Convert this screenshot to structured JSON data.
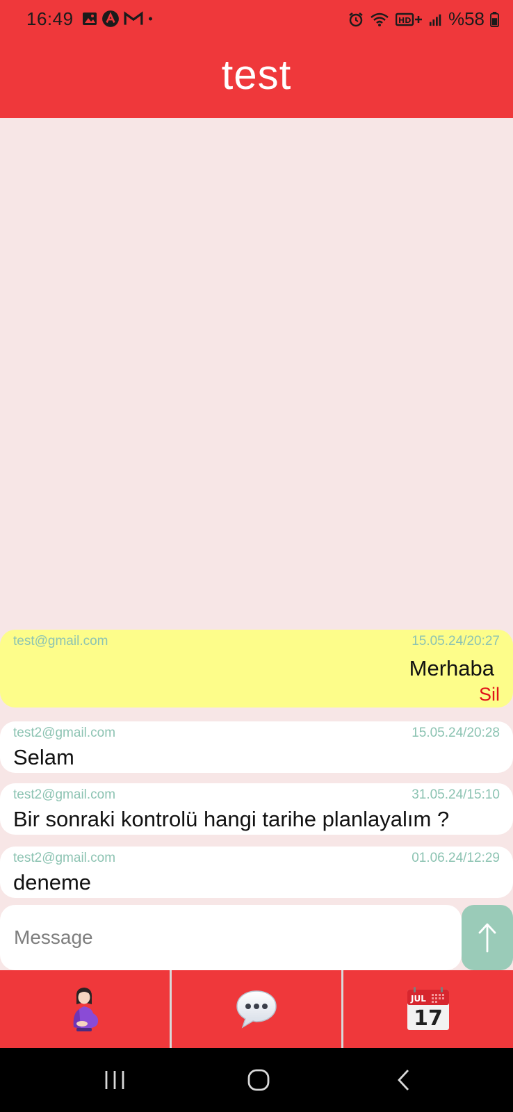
{
  "status": {
    "time": "16:49",
    "battery": "%58",
    "icons": [
      "gallery-icon",
      "app-notification-icon",
      "gmail-icon",
      "dot-icon",
      "alarm-icon",
      "wifi-icon",
      "hd-plus-icon",
      "signal-icon",
      "battery-icon"
    ]
  },
  "header": {
    "title": "test"
  },
  "messages": [
    {
      "email": "test@gmail.com",
      "date": "15.05.24/20:27",
      "text": "Merhaba",
      "own": true,
      "delete_label": "Sil"
    },
    {
      "email": "test2@gmail.com",
      "date": "15.05.24/20:28",
      "text": "Selam",
      "own": false
    },
    {
      "email": "test2@gmail.com",
      "date": "31.05.24/15:10",
      "text": "Bir sonraki kontrolü hangi tarihe planlayalım ?",
      "own": false
    },
    {
      "email": "test2@gmail.com",
      "date": "01.06.24/12:29",
      "text": "deneme",
      "own": false
    }
  ],
  "composer": {
    "placeholder": "Message",
    "value": "",
    "send_icon": "arrow-up-icon"
  },
  "tabs": [
    {
      "icon": "pregnant-woman-icon"
    },
    {
      "icon": "speech-bubble-icon"
    },
    {
      "icon": "calendar-icon",
      "month": "JUL",
      "day": "17"
    }
  ],
  "nav": [
    "recents-icon",
    "home-icon",
    "back-icon"
  ],
  "colors": {
    "primary": "#ef383b",
    "background": "#f7e6e6",
    "own_message": "#fdfd8a",
    "meta_text": "#8cc3b2",
    "delete": "#e0121a",
    "send_button": "#9acbb8"
  }
}
